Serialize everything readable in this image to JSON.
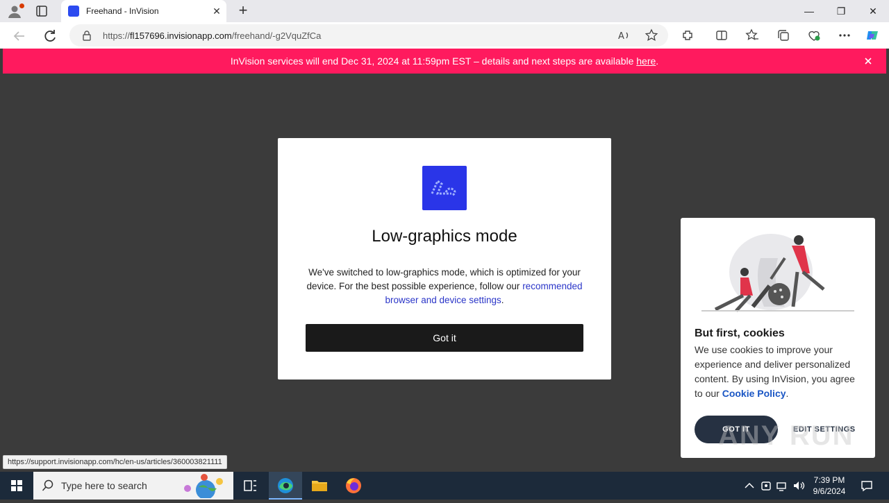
{
  "browser": {
    "tab_title": "Freehand - InVision",
    "tab_close": "✕",
    "new_tab": "+",
    "url_prefix": "https://",
    "url_host": "fl157696.invisionapp.com",
    "url_path": "/freehand/-g2VquZfCa",
    "window_controls": {
      "minimize": "—",
      "restore": "❐",
      "close": "✕"
    }
  },
  "banner": {
    "text": "InVision services will end Dec 31, 2024 at 11:59pm EST – details and next steps are available ",
    "link": "here",
    "suffix": "."
  },
  "modal": {
    "title": "Low-graphics mode",
    "body_1": "We've switched to low-graphics mode, which is optimized for your device. For the best possible experience, follow our ",
    "body_link": "recommended browser and device settings",
    "body_2": ".",
    "button": "Got it",
    "logo_color": "#2a35e8"
  },
  "cookie": {
    "title": "But first, cookies",
    "body": "We use cookies to improve your experience and deliver personalized content. By using InVision, you agree to our ",
    "policy_link": "Cookie Policy",
    "body_end": ".",
    "got_it": "GOT IT",
    "edit_settings": "EDIT SETTINGS"
  },
  "status_bar": {
    "url": "https://support.invisionapp.com/hc/en-us/articles/360003821111"
  },
  "watermark": "ANY RUN",
  "taskbar": {
    "search_placeholder": "Type here to search",
    "time": "7:39 PM",
    "date": "9/6/2024"
  },
  "colors": {
    "banner": "#ff1a5e",
    "page_bg": "#3b3b3b",
    "accent": "#2a35e8",
    "taskbar": "#1c2a3a"
  }
}
